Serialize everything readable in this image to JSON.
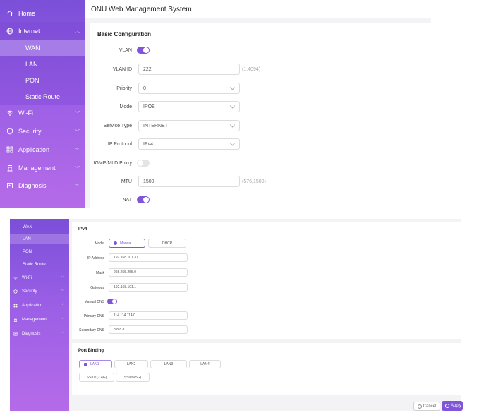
{
  "header": {
    "title": "ONU Web Management System"
  },
  "sidebar_top": {
    "items": [
      {
        "label": "Home",
        "icon": "home-icon"
      },
      {
        "label": "Internet",
        "icon": "globe-icon"
      },
      {
        "label": "WAN"
      },
      {
        "label": "LAN"
      },
      {
        "label": "PON"
      },
      {
        "label": "Static Route"
      },
      {
        "label": "Wi-Fi",
        "icon": "wifi-icon"
      },
      {
        "label": "Security",
        "icon": "shield-icon"
      },
      {
        "label": "Application",
        "icon": "apps-icon"
      },
      {
        "label": "Management",
        "icon": "management-icon"
      },
      {
        "label": "Diagnosis",
        "icon": "diagnosis-icon"
      }
    ]
  },
  "basic": {
    "title": "Basic Configuration",
    "vlan_label": "VLAN",
    "vlan_id_label": "VLAN ID",
    "vlan_id_value": "222",
    "vlan_id_hint": "(1,4094)",
    "priority_label": "Priority",
    "priority_value": "0",
    "mode_label": "Mode",
    "mode_value": "IPOE",
    "service_type_label": "Service Type",
    "service_type_value": "INTERNET",
    "ip_protocol_label": "IP Protocol",
    "ip_protocol_value": "IPv4",
    "igmp_label": "IGMP/MLD Proxy",
    "mtu_label": "MTU",
    "mtu_value": "1500",
    "mtu_hint": "(576,1500)",
    "nat_label": "NAT"
  },
  "sidebar_bottom": {
    "items": [
      {
        "label": "WAN"
      },
      {
        "label": "LAN"
      },
      {
        "label": "PON"
      },
      {
        "label": "Static Route"
      },
      {
        "label": "Wi-Fi",
        "icon": "wifi-icon"
      },
      {
        "label": "Security",
        "icon": "shield-icon"
      },
      {
        "label": "Application",
        "icon": "apps-icon"
      },
      {
        "label": "Management",
        "icon": "management-icon"
      },
      {
        "label": "Diagnosis",
        "icon": "diagnosis-icon"
      }
    ]
  },
  "ipv4": {
    "title": "IPv4",
    "model_label": "Model",
    "model_manual": "Manual",
    "model_dhcp": "DHCP",
    "ip_label": "IP Address",
    "ip_value": "192.168.101.37",
    "mask_label": "Mask",
    "mask_value": "255.255.255.0",
    "gateway_label": "Gateway",
    "gateway_value": "192.168.101.1",
    "manual_dns_label": "Manual DNS",
    "primary_dns_label": "Primary DNS",
    "primary_dns_value": "114.114.114.0",
    "secondary_dns_label": "Secondary DNS",
    "secondary_dns_value": "8.8.8.8"
  },
  "port_binding": {
    "title": "Port Binding",
    "ports": [
      "LAN1",
      "LAN2",
      "LAN3",
      "LAN4"
    ],
    "ssids": [
      "SSID1(2.4G)",
      "SSID5(5G)"
    ]
  },
  "footer": {
    "cancel_label": "Cancel",
    "apply_label": "Apply"
  },
  "colors": {
    "accent": "#7f56d9",
    "sidebar_top": "#7b4fd8",
    "sidebar_bottom": "#b56be8"
  }
}
